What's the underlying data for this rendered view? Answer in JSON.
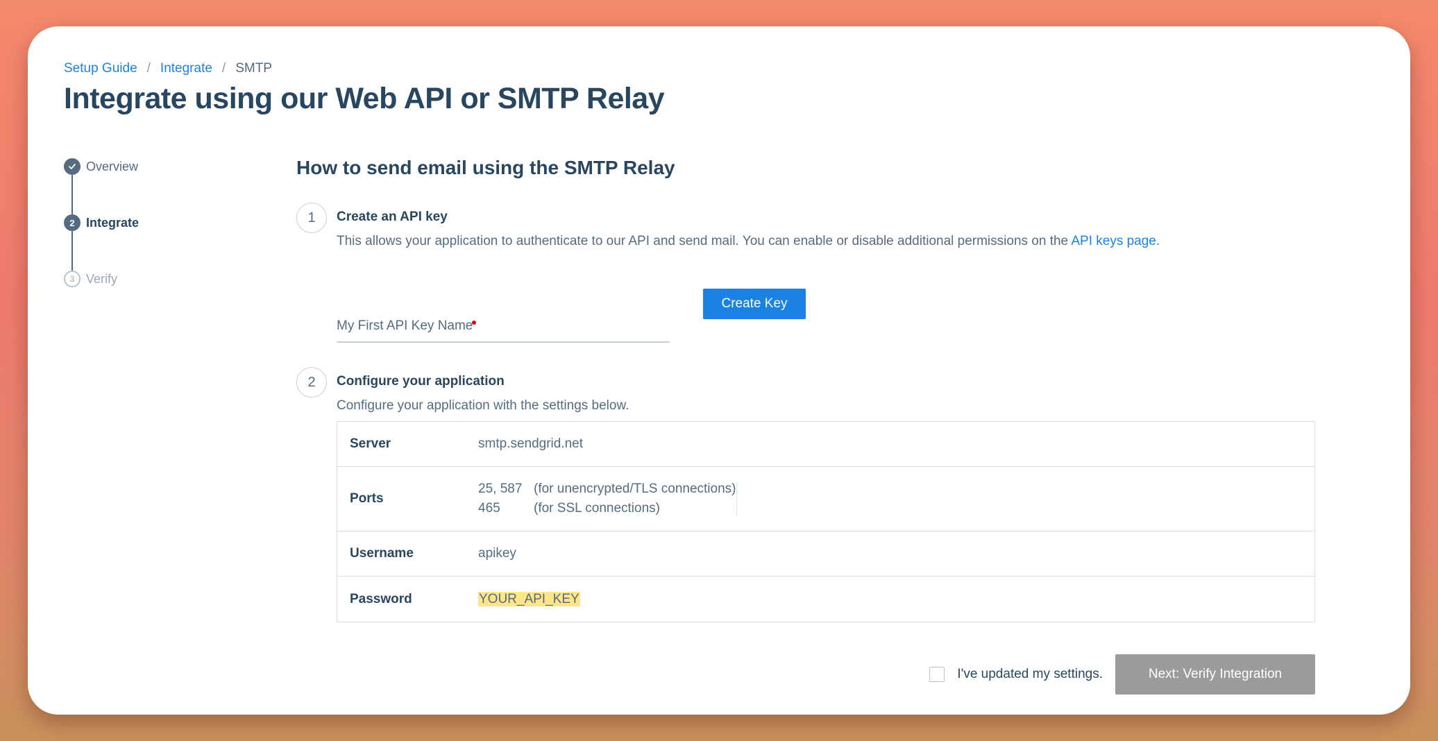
{
  "breadcrumb": {
    "items": [
      "Setup Guide",
      "Integrate"
    ],
    "separator": "/",
    "current": "SMTP"
  },
  "page_title": "Integrate using our Web API or SMTP Relay",
  "stepper": {
    "steps": [
      {
        "label": "Overview",
        "state": "done",
        "marker": ""
      },
      {
        "label": "Integrate",
        "state": "active",
        "marker": "2"
      },
      {
        "label": "Verify",
        "state": "todo",
        "marker": "3"
      }
    ]
  },
  "section_title": "How to send email using the SMTP Relay",
  "step1": {
    "number": "1",
    "title": "Create an API key",
    "desc": "This allows your application to authenticate to our API and send mail. You can enable or disable additional permissions on the ",
    "link": "API keys page",
    "desc_end": ".",
    "input_placeholder": "My First API Key Name",
    "button": "Create Key"
  },
  "step2": {
    "number": "2",
    "title": "Configure your application",
    "desc": "Configure your application with the settings below."
  },
  "settings": {
    "server": {
      "key": "Server",
      "value": "smtp.sendgrid.net"
    },
    "ports": {
      "key": "Ports",
      "rows": [
        {
          "port": "25, 587",
          "note": "(for unencrypted/TLS connections)"
        },
        {
          "port": "465",
          "note": "(for SSL connections)"
        }
      ]
    },
    "username": {
      "key": "Username",
      "value": "apikey"
    },
    "password": {
      "key": "Password",
      "value": "YOUR_API_KEY"
    }
  },
  "footer": {
    "checkbox_label": "I've updated my settings.",
    "next_button": "Next: Verify Integration"
  },
  "colors": {
    "accent": "#1a82e2",
    "heading": "#294661",
    "body_text": "#546b81",
    "highlight": "#ffe58a",
    "disabled_button": "#9b9b9b",
    "required": "#d0021b"
  }
}
